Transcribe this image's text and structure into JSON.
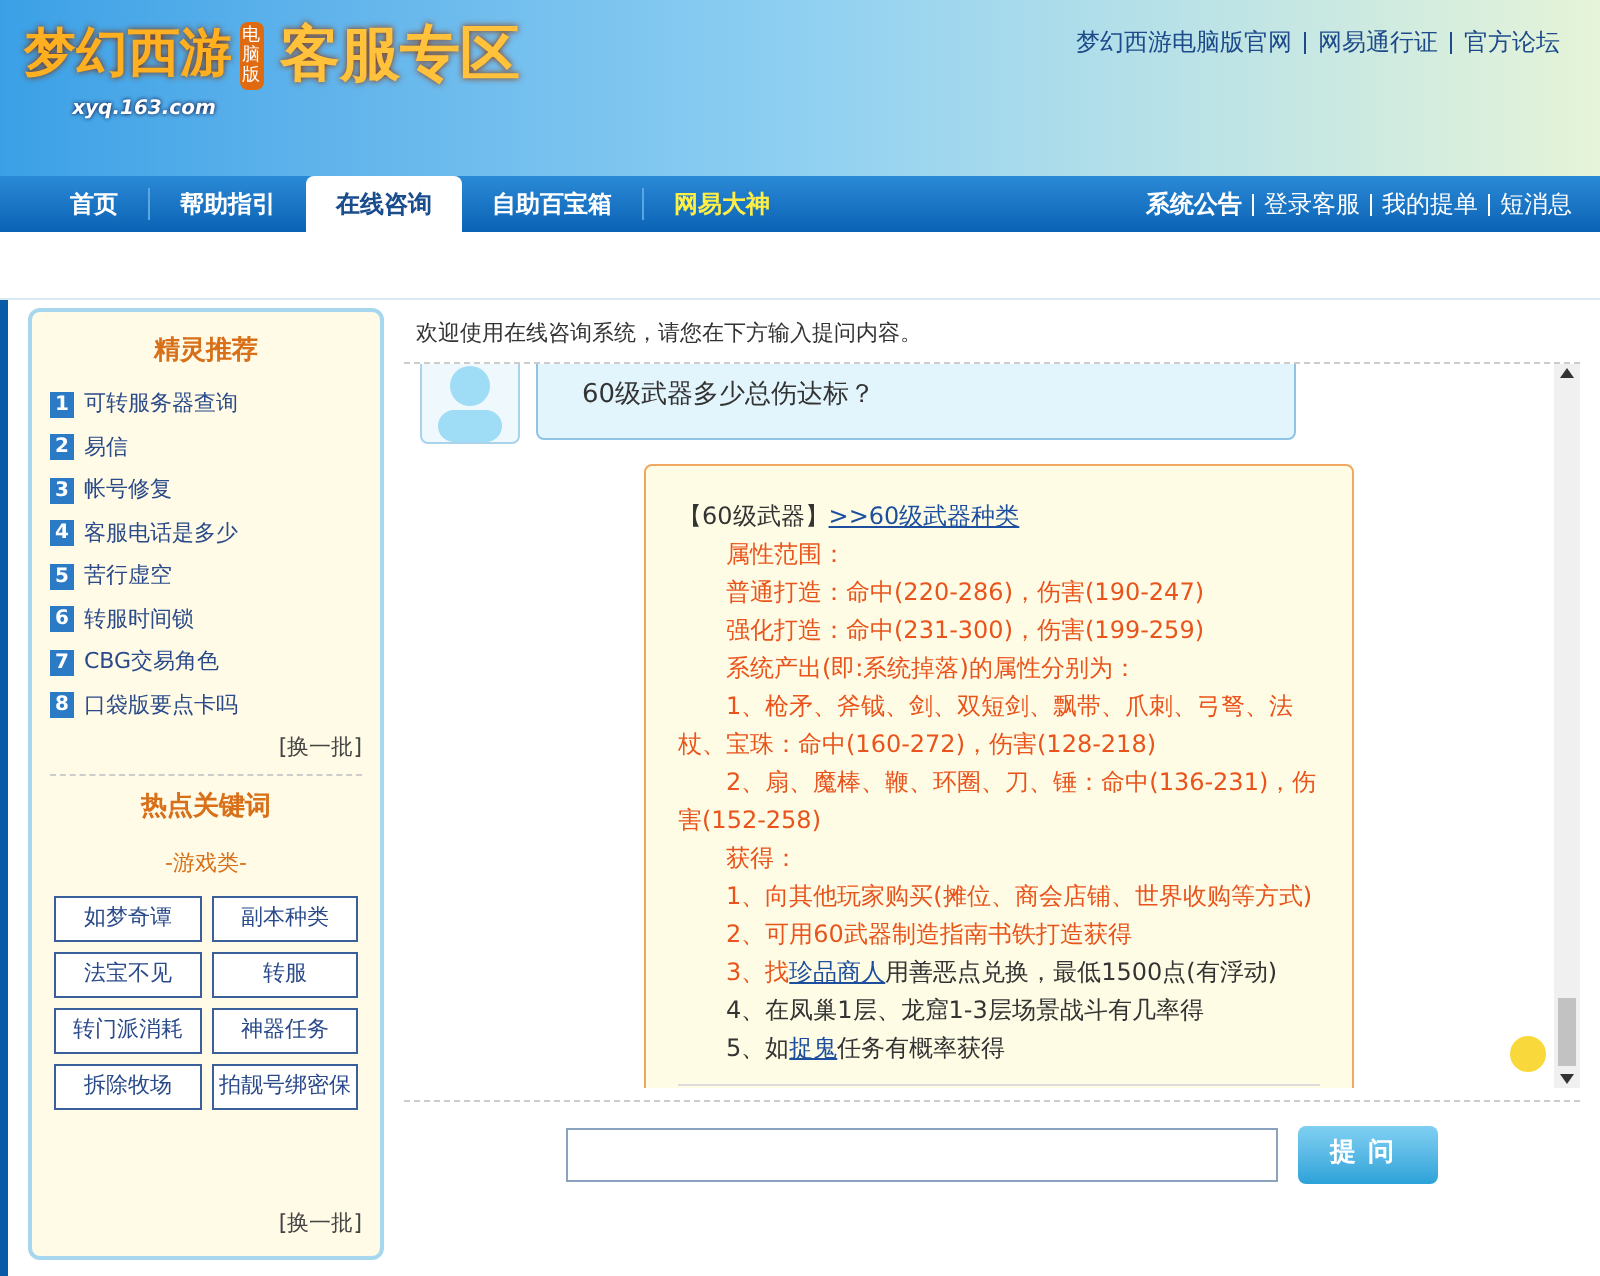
{
  "header": {
    "logo_title": "梦幻西游",
    "logo_badge": "电脑版",
    "logo_domain": "xyq.163.com",
    "section_title": "客服专区",
    "top_links": [
      "梦幻西游电脑版官网",
      "网易通行证",
      "官方论坛"
    ]
  },
  "nav": {
    "tabs": [
      {
        "label": "首页",
        "selected": false,
        "highlight": false
      },
      {
        "label": "帮助指引",
        "selected": false,
        "highlight": false
      },
      {
        "label": "在线咨询",
        "selected": true,
        "highlight": false
      },
      {
        "label": "自助百宝箱",
        "selected": false,
        "highlight": false
      },
      {
        "label": "网易大神",
        "selected": false,
        "highlight": true
      }
    ],
    "right_links": [
      "系统公告",
      "登录客服",
      "我的提单",
      "短消息"
    ]
  },
  "sidebar": {
    "recommend_title": "精灵推荐",
    "recommend_items": [
      {
        "number": "1",
        "label": "可转服务器查询"
      },
      {
        "number": "2",
        "label": "易信"
      },
      {
        "number": "3",
        "label": "帐号修复"
      },
      {
        "number": "4",
        "label": "客服电话是多少"
      },
      {
        "number": "5",
        "label": "苦行虚空"
      },
      {
        "number": "6",
        "label": "转服时间锁"
      },
      {
        "number": "7",
        "label": "CBG交易角色"
      },
      {
        "number": "8",
        "label": "口袋版要点卡吗"
      }
    ],
    "recommend_refresh": "[换一批]",
    "keywords_title": "热点关键词",
    "keywords_category": "-游戏类-",
    "keywords": [
      "如梦奇谭",
      "副本种类",
      "法宝不见",
      "转服",
      "转门派消耗",
      "神器任务",
      "拆除牧场",
      "拍靓号绑密保"
    ],
    "keywords_refresh": "[换一批]"
  },
  "chat": {
    "welcome": "欢迎使用在线咨询系统，请您在下方输入提问内容。",
    "question": "60级武器多少总伤达标？",
    "answer": [
      {
        "indent": false,
        "segments": [
          {
            "kind": "plain",
            "text": "【60级武器】"
          },
          {
            "kind": "link",
            "text": ">>60级武器种类"
          }
        ]
      },
      {
        "indent": true,
        "segments": [
          {
            "kind": "accent",
            "text": "属性范围："
          }
        ]
      },
      {
        "indent": true,
        "segments": [
          {
            "kind": "accent",
            "text": "普通打造：命中(220-286)，伤害(190-247)"
          }
        ]
      },
      {
        "indent": true,
        "segments": [
          {
            "kind": "accent",
            "text": "强化打造：命中(231-300)，伤害(199-259)"
          }
        ]
      },
      {
        "indent": true,
        "segments": [
          {
            "kind": "accent",
            "text": "系统产出(即:系统掉落)的属性分别为："
          }
        ]
      },
      {
        "indent": true,
        "segments": [
          {
            "kind": "accent",
            "text": "1、枪矛、斧钺、剑、双短剑、飘带、爪刺、弓弩、法杖、宝珠：命中(160-272)，伤害(128-218)"
          }
        ]
      },
      {
        "indent": true,
        "segments": [
          {
            "kind": "accent",
            "text": "2、扇、魔棒、鞭、环圈、刀、锤：命中(136-231)，伤害(152-258)"
          }
        ]
      },
      {
        "indent": true,
        "segments": [
          {
            "kind": "accent",
            "text": "获得："
          }
        ]
      },
      {
        "indent": true,
        "segments": [
          {
            "kind": "accent",
            "text": "1、向其他玩家购买(摊位、商会店铺、世界收购等方式)"
          }
        ]
      },
      {
        "indent": true,
        "segments": [
          {
            "kind": "accent",
            "text": "2、可用60武器制造指南书铁打造获得"
          }
        ]
      },
      {
        "indent": true,
        "segments": [
          {
            "kind": "accent",
            "text": "3、找"
          },
          {
            "kind": "link",
            "text": "珍品商人"
          },
          {
            "kind": "plain",
            "text": "用善恶点兑换，最低1500点(有浮动)"
          }
        ]
      },
      {
        "indent": true,
        "segments": [
          {
            "kind": "plain",
            "text": "4、在凤巢1层、龙窟1-3层场景战斗有几率得"
          }
        ]
      },
      {
        "indent": true,
        "segments": [
          {
            "kind": "plain",
            "text": "5、如"
          },
          {
            "kind": "link",
            "text": "捉鬼"
          },
          {
            "kind": "plain",
            "text": "任务有概率获得"
          }
        ]
      }
    ],
    "ask_button": "提问"
  }
}
